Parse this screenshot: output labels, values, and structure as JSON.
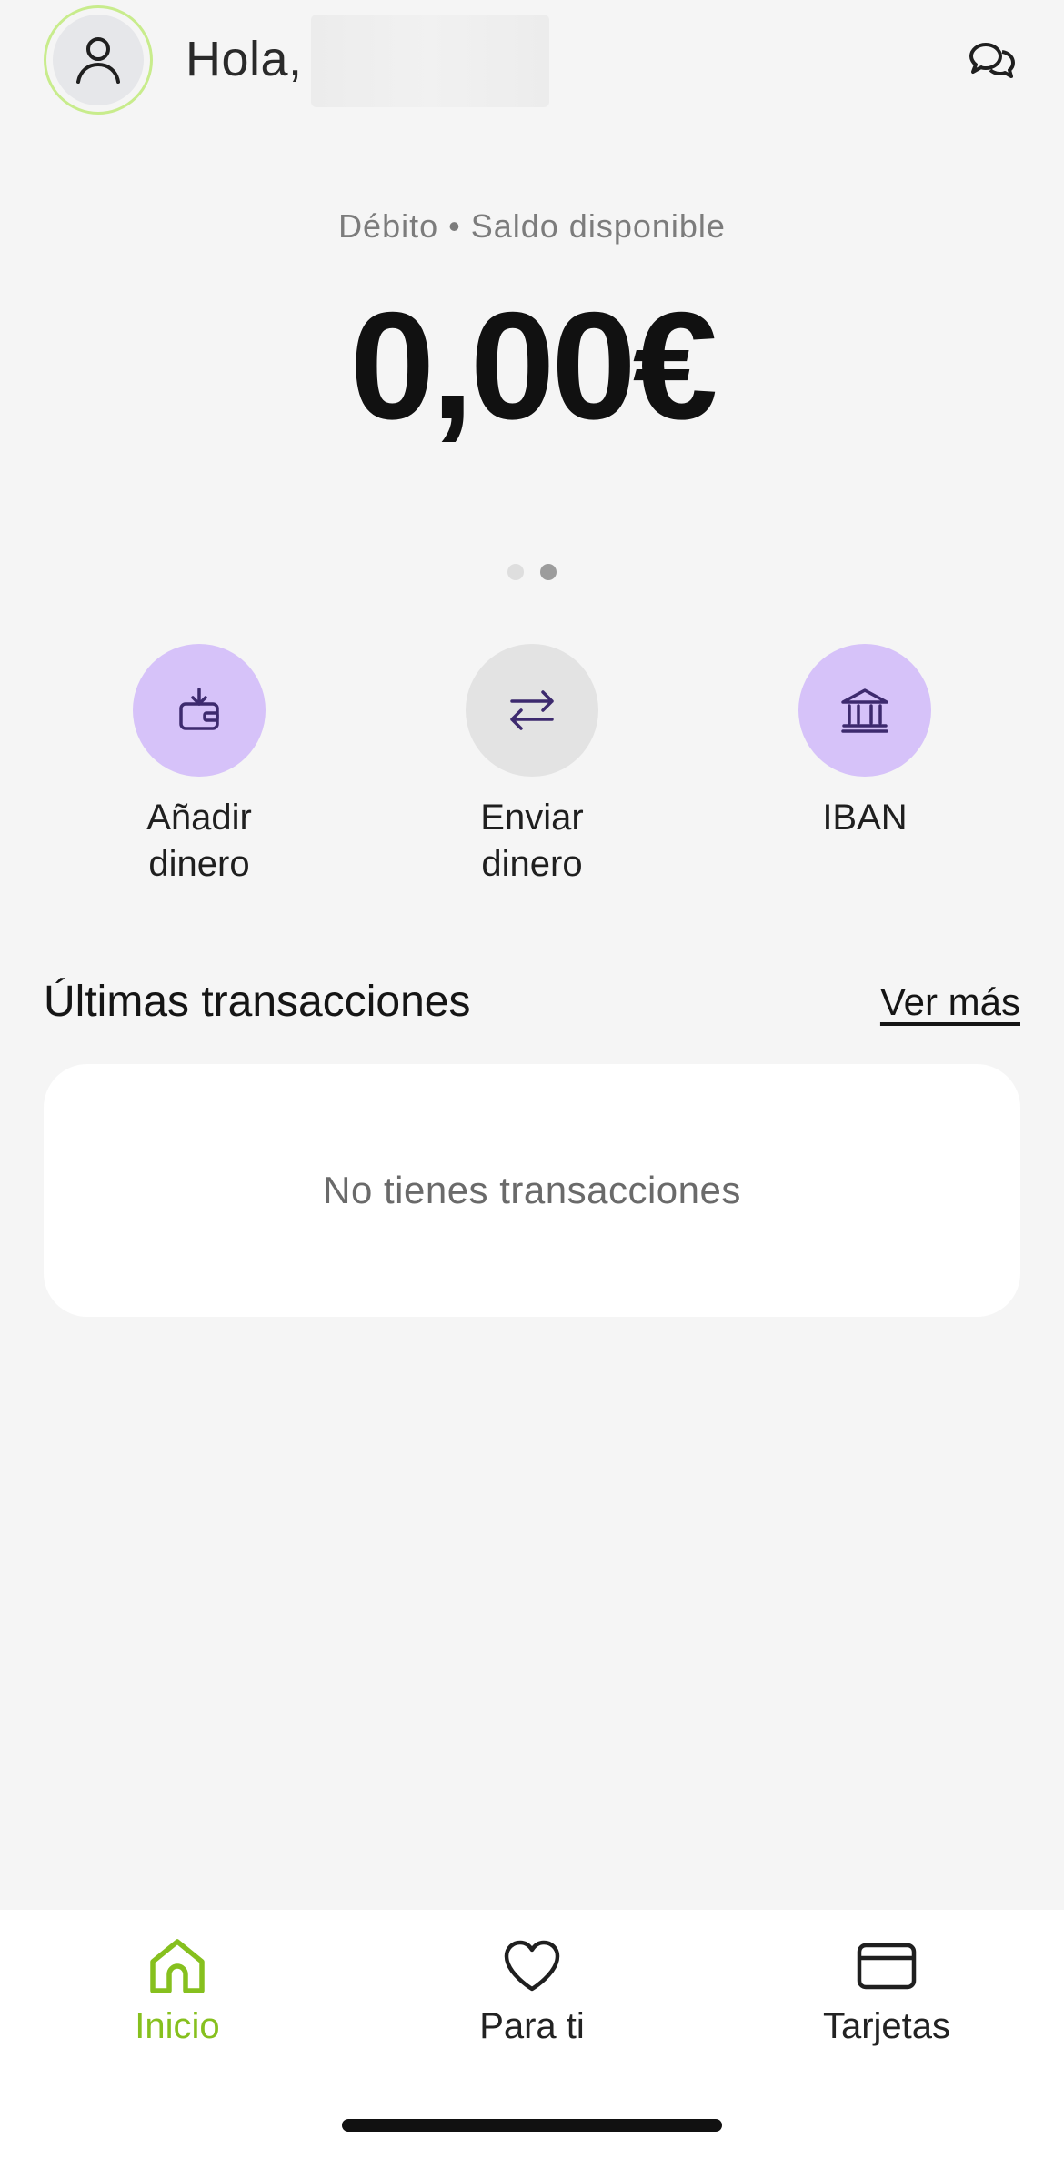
{
  "header": {
    "greeting": "Hola,",
    "avatar_icon": "user-icon",
    "chat_icon": "chat-bubbles-icon"
  },
  "balance": {
    "label": "Débito • Saldo disponible",
    "amount": "0,00€",
    "carousel_pages": 2,
    "carousel_active": 2
  },
  "actions": [
    {
      "label": "Añadir\ndinero",
      "icon": "wallet-download-icon",
      "color": "#d6c2f9"
    },
    {
      "label": "Enviar\ndinero",
      "icon": "transfer-arrows-icon",
      "color": "#e3e3e3"
    },
    {
      "label": "IBAN",
      "icon": "bank-icon",
      "color": "#d6c2f9"
    }
  ],
  "transactions": {
    "title": "Últimas transacciones",
    "more_link": "Ver más",
    "empty_message": "No tienes transacciones"
  },
  "bottom_nav": {
    "items": [
      {
        "label": "Inicio",
        "icon": "home-icon",
        "active": true
      },
      {
        "label": "Para ti",
        "icon": "heart-icon",
        "active": false
      },
      {
        "label": "Tarjetas",
        "icon": "card-icon",
        "active": false
      }
    ],
    "active_color": "#86c01e"
  }
}
